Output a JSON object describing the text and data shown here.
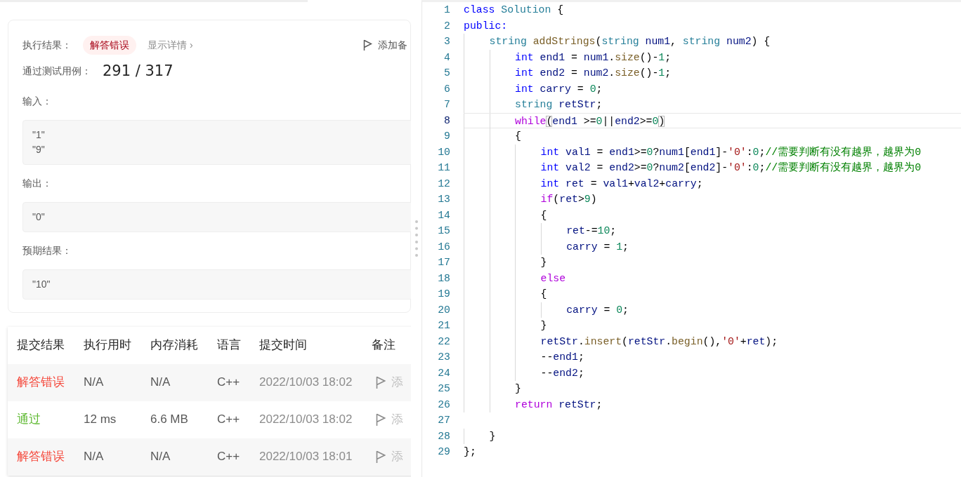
{
  "result": {
    "label": "执行结果：",
    "status": {
      "text": "解答错误",
      "color": "#a8071a"
    },
    "details_link": "显示详情 ›",
    "note_button": "添加备",
    "passed_label": "通过测试用例：",
    "passed": "291",
    "separator": "/",
    "total": "317",
    "sections": [
      {
        "label": "输入：",
        "lines": [
          "\"1\"",
          "\"9\""
        ]
      },
      {
        "label": "输出：",
        "lines": [
          "\"0\""
        ]
      },
      {
        "label": "预期结果：",
        "lines": [
          "\"10\""
        ]
      }
    ]
  },
  "submissions": {
    "columns": [
      "提交结果",
      "执行用时",
      "内存消耗",
      "语言",
      "提交时间",
      "备注"
    ],
    "rows": [
      {
        "status": "解答错误",
        "color": "#f5483b",
        "runtime": "N/A",
        "memory": "N/A",
        "language": "C++",
        "time": "2022/10/03 18:02",
        "note": "添"
      },
      {
        "status": "通过",
        "color": "#5cb82f",
        "runtime": "12 ms",
        "memory": "6.6 MB",
        "language": "C++",
        "time": "2022/10/03 18:02",
        "note": "添"
      },
      {
        "status": "解答错误",
        "color": "#f5483b",
        "runtime": "N/A",
        "memory": "N/A",
        "language": "C++",
        "time": "2022/10/03 18:01",
        "note": "添"
      }
    ]
  },
  "editor": {
    "lines": [
      {
        "number": "1",
        "current": false,
        "tokens": [
          {
            "kind": "kw",
            "text": "class"
          },
          {
            "kind": "ty",
            "text": " Solution"
          },
          {
            "kind": "p",
            "text": " {"
          }
        ]
      },
      {
        "number": "2",
        "current": false,
        "tokens": [
          {
            "kind": "kw",
            "text": "public:"
          }
        ]
      },
      {
        "number": "3",
        "current": false,
        "tokens": [
          {
            "kind": "ty",
            "text": "    string"
          },
          {
            "kind": "fn",
            "text": " addStrings"
          },
          {
            "kind": "p",
            "text": "("
          },
          {
            "kind": "ty",
            "text": "string"
          },
          {
            "kind": "var",
            "text": " num1"
          },
          {
            "kind": "p",
            "text": ", "
          },
          {
            "kind": "ty",
            "text": "string"
          },
          {
            "kind": "var",
            "text": " num2"
          },
          {
            "kind": "p",
            "text": ") {"
          }
        ]
      },
      {
        "number": "4",
        "current": false,
        "tokens": [
          {
            "kind": "kw",
            "text": "        int"
          },
          {
            "kind": "var",
            "text": " end1"
          },
          {
            "kind": "p",
            "text": " = "
          },
          {
            "kind": "var",
            "text": "num1"
          },
          {
            "kind": "p",
            "text": "."
          },
          {
            "kind": "fn",
            "text": "size"
          },
          {
            "kind": "p",
            "text": "()-"
          },
          {
            "kind": "num",
            "text": "1"
          },
          {
            "kind": "p",
            "text": ";"
          }
        ]
      },
      {
        "number": "5",
        "current": false,
        "tokens": [
          {
            "kind": "kw",
            "text": "        int"
          },
          {
            "kind": "var",
            "text": " end2"
          },
          {
            "kind": "p",
            "text": " = "
          },
          {
            "kind": "var",
            "text": "num2"
          },
          {
            "kind": "p",
            "text": "."
          },
          {
            "kind": "fn",
            "text": "size"
          },
          {
            "kind": "p",
            "text": "()-"
          },
          {
            "kind": "num",
            "text": "1"
          },
          {
            "kind": "p",
            "text": ";"
          }
        ]
      },
      {
        "number": "6",
        "current": false,
        "tokens": [
          {
            "kind": "kw",
            "text": "        int"
          },
          {
            "kind": "var",
            "text": " carry"
          },
          {
            "kind": "p",
            "text": " = "
          },
          {
            "kind": "num",
            "text": "0"
          },
          {
            "kind": "p",
            "text": ";"
          }
        ]
      },
      {
        "number": "7",
        "current": false,
        "tokens": [
          {
            "kind": "ty",
            "text": "        string"
          },
          {
            "kind": "var",
            "text": " retStr"
          },
          {
            "kind": "p",
            "text": ";"
          }
        ]
      },
      {
        "number": "8",
        "current": true,
        "tokens": [
          {
            "kind": "ctl",
            "text": "        while"
          },
          {
            "kind": "br",
            "text": "("
          },
          {
            "kind": "var",
            "text": "end1"
          },
          {
            "kind": "p",
            "text": " >="
          },
          {
            "kind": "num",
            "text": "0"
          },
          {
            "kind": "p",
            "text": "||"
          },
          {
            "kind": "var",
            "text": "end2"
          },
          {
            "kind": "p",
            "text": ">="
          },
          {
            "kind": "num",
            "text": "0"
          },
          {
            "kind": "br",
            "text": ")"
          }
        ]
      },
      {
        "number": "9",
        "current": false,
        "tokens": [
          {
            "kind": "p",
            "text": "        {"
          }
        ]
      },
      {
        "number": "10",
        "current": false,
        "tokens": [
          {
            "kind": "kw",
            "text": "            int"
          },
          {
            "kind": "var",
            "text": " val1"
          },
          {
            "kind": "p",
            "text": " = "
          },
          {
            "kind": "var",
            "text": "end1"
          },
          {
            "kind": "p",
            "text": ">="
          },
          {
            "kind": "num",
            "text": "0"
          },
          {
            "kind": "p",
            "text": "?"
          },
          {
            "kind": "var",
            "text": "num1"
          },
          {
            "kind": "p",
            "text": "["
          },
          {
            "kind": "var",
            "text": "end1"
          },
          {
            "kind": "p",
            "text": "]-"
          },
          {
            "kind": "str",
            "text": "'0'"
          },
          {
            "kind": "p",
            "text": ":"
          },
          {
            "kind": "num",
            "text": "0"
          },
          {
            "kind": "p",
            "text": ";"
          },
          {
            "kind": "cmt",
            "text": "//需要判断有没有越界，越界为0"
          }
        ]
      },
      {
        "number": "11",
        "current": false,
        "tokens": [
          {
            "kind": "kw",
            "text": "            int"
          },
          {
            "kind": "var",
            "text": " val2"
          },
          {
            "kind": "p",
            "text": " = "
          },
          {
            "kind": "var",
            "text": "end2"
          },
          {
            "kind": "p",
            "text": ">="
          },
          {
            "kind": "num",
            "text": "0"
          },
          {
            "kind": "p",
            "text": "?"
          },
          {
            "kind": "var",
            "text": "num2"
          },
          {
            "kind": "p",
            "text": "["
          },
          {
            "kind": "var",
            "text": "end2"
          },
          {
            "kind": "p",
            "text": "]-"
          },
          {
            "kind": "str",
            "text": "'0'"
          },
          {
            "kind": "p",
            "text": ":"
          },
          {
            "kind": "num",
            "text": "0"
          },
          {
            "kind": "p",
            "text": ";"
          },
          {
            "kind": "cmt",
            "text": "//需要判断有没有越界，越界为0"
          }
        ]
      },
      {
        "number": "12",
        "current": false,
        "tokens": [
          {
            "kind": "kw",
            "text": "            int"
          },
          {
            "kind": "var",
            "text": " ret"
          },
          {
            "kind": "p",
            "text": " = "
          },
          {
            "kind": "var",
            "text": "val1"
          },
          {
            "kind": "p",
            "text": "+"
          },
          {
            "kind": "var",
            "text": "val2"
          },
          {
            "kind": "p",
            "text": "+"
          },
          {
            "kind": "var",
            "text": "carry"
          },
          {
            "kind": "p",
            "text": ";"
          }
        ]
      },
      {
        "number": "13",
        "current": false,
        "tokens": [
          {
            "kind": "ctl",
            "text": "            if"
          },
          {
            "kind": "p",
            "text": "("
          },
          {
            "kind": "var",
            "text": "ret"
          },
          {
            "kind": "p",
            "text": ">"
          },
          {
            "kind": "num",
            "text": "9"
          },
          {
            "kind": "p",
            "text": ")"
          }
        ]
      },
      {
        "number": "14",
        "current": false,
        "tokens": [
          {
            "kind": "p",
            "text": "            {"
          }
        ]
      },
      {
        "number": "15",
        "current": false,
        "tokens": [
          {
            "kind": "var",
            "text": "                ret"
          },
          {
            "kind": "p",
            "text": "-="
          },
          {
            "kind": "num",
            "text": "10"
          },
          {
            "kind": "p",
            "text": ";"
          }
        ]
      },
      {
        "number": "16",
        "current": false,
        "tokens": [
          {
            "kind": "var",
            "text": "                carry"
          },
          {
            "kind": "p",
            "text": " = "
          },
          {
            "kind": "num",
            "text": "1"
          },
          {
            "kind": "p",
            "text": ";"
          }
        ]
      },
      {
        "number": "17",
        "current": false,
        "tokens": [
          {
            "kind": "p",
            "text": "            }"
          }
        ]
      },
      {
        "number": "18",
        "current": false,
        "tokens": [
          {
            "kind": "ctl",
            "text": "            else"
          }
        ]
      },
      {
        "number": "19",
        "current": false,
        "tokens": [
          {
            "kind": "p",
            "text": "            {"
          }
        ]
      },
      {
        "number": "20",
        "current": false,
        "tokens": [
          {
            "kind": "var",
            "text": "                carry"
          },
          {
            "kind": "p",
            "text": " = "
          },
          {
            "kind": "num",
            "text": "0"
          },
          {
            "kind": "p",
            "text": ";"
          }
        ]
      },
      {
        "number": "21",
        "current": false,
        "tokens": [
          {
            "kind": "p",
            "text": "            }"
          }
        ]
      },
      {
        "number": "22",
        "current": false,
        "tokens": [
          {
            "kind": "var",
            "text": "            retStr"
          },
          {
            "kind": "p",
            "text": "."
          },
          {
            "kind": "fn",
            "text": "insert"
          },
          {
            "kind": "p",
            "text": "("
          },
          {
            "kind": "var",
            "text": "retStr"
          },
          {
            "kind": "p",
            "text": "."
          },
          {
            "kind": "fn",
            "text": "begin"
          },
          {
            "kind": "p",
            "text": "(),"
          },
          {
            "kind": "str",
            "text": "'0'"
          },
          {
            "kind": "p",
            "text": "+"
          },
          {
            "kind": "var",
            "text": "ret"
          },
          {
            "kind": "p",
            "text": ");"
          }
        ]
      },
      {
        "number": "23",
        "current": false,
        "tokens": [
          {
            "kind": "p",
            "text": "            --"
          },
          {
            "kind": "var",
            "text": "end1"
          },
          {
            "kind": "p",
            "text": ";"
          }
        ]
      },
      {
        "number": "24",
        "current": false,
        "tokens": [
          {
            "kind": "p",
            "text": "            --"
          },
          {
            "kind": "var",
            "text": "end2"
          },
          {
            "kind": "p",
            "text": ";"
          }
        ]
      },
      {
        "number": "25",
        "current": false,
        "tokens": [
          {
            "kind": "p",
            "text": "        }"
          }
        ]
      },
      {
        "number": "26",
        "current": false,
        "tokens": [
          {
            "kind": "ctl",
            "text": "        return"
          },
          {
            "kind": "var",
            "text": " retStr"
          },
          {
            "kind": "p",
            "text": ";"
          }
        ]
      },
      {
        "number": "27",
        "current": false
      },
      {
        "number": "28",
        "current": false,
        "tokens": [
          {
            "kind": "p",
            "text": "    }"
          }
        ]
      },
      {
        "number": "29",
        "current": false,
        "tokens": [
          {
            "kind": "p",
            "text": "};"
          }
        ]
      }
    ]
  }
}
